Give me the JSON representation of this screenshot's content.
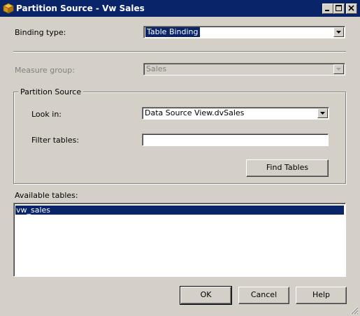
{
  "window": {
    "title": "Partition Source - Vw Sales",
    "icon": "cube-icon",
    "controls": [
      "minimize-icon",
      "maximize-icon",
      "close-icon"
    ]
  },
  "binding_type": {
    "label": "Binding type:",
    "value": "Table Binding"
  },
  "measure_group": {
    "label": "Measure group:",
    "value": "Sales",
    "enabled": false
  },
  "partition_source": {
    "title": "Partition Source",
    "look_in_label": "Look in:",
    "look_in_value": "Data Source View.dvSales",
    "filter_label": "Filter tables:",
    "filter_value": "",
    "find_button": "Find Tables"
  },
  "available_tables": {
    "label": "Available tables:",
    "items": [
      "vw_sales"
    ],
    "selected_index": 0
  },
  "buttons": {
    "ok": "OK",
    "cancel": "Cancel",
    "help": "Help"
  },
  "colors": {
    "titlebar": "#0a246a",
    "selection": "#0a246a",
    "face": "#d4d0c8"
  }
}
